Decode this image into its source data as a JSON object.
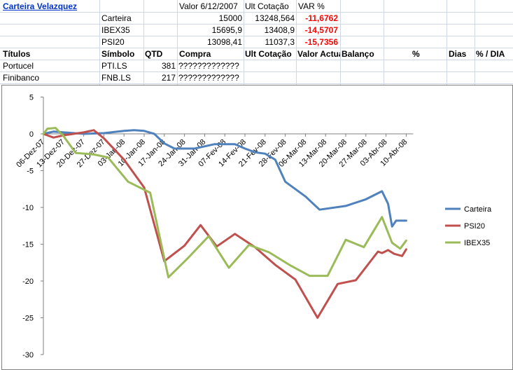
{
  "sheet": {
    "title": "Carteira Velazquez",
    "summary_headers": [
      "Valor 6/12/2007",
      "Ult Cotação",
      "VAR %"
    ],
    "summary_rows": [
      {
        "name": "Carteira",
        "valor": "15000",
        "ult": "13248,564",
        "var": "-11,6762"
      },
      {
        "name": "IBEX35",
        "valor": "15695,9",
        "ult": "13408,9",
        "var": "-14,5707"
      },
      {
        "name": "PSI20",
        "valor": "13098,41",
        "ult": "11037,3",
        "var": "-15,7356"
      }
    ],
    "table_headers": [
      "Títulos",
      "Símbolo",
      "QTD",
      "Compra",
      "Ult Cotação",
      "Valor Actual",
      "Balanço",
      "%",
      "Dias",
      "% / DIA"
    ],
    "rows": [
      {
        "titulo": "Portucel",
        "simbolo": "PTI.LS",
        "qtd": "381",
        "compra": "?????????????"
      },
      {
        "titulo": "Finibanco",
        "simbolo": "FNB.LS",
        "qtd": "217",
        "compra": "?????????????"
      }
    ]
  },
  "chart_data": {
    "type": "line",
    "categories": [
      "06-Dez-07",
      "13-Dez-07",
      "20-Dez-07",
      "27-Dez-07",
      "03-Jan-08",
      "10-Jan-08",
      "17-Jan-08",
      "24-Jan-08",
      "31-Jan-08",
      "07-Fev-08",
      "14-Fev-08",
      "21-Fev-08",
      "28-Fev-08",
      "06-Mar-08",
      "13-Mar-08",
      "20-Mar-08",
      "27-Mar-08",
      "03-Abr-08",
      "10-Abr-08"
    ],
    "ylim": [
      -30,
      5
    ],
    "yticks": [
      "5",
      "0",
      "-5",
      "-10",
      "-15",
      "-20",
      "-25",
      "-30"
    ],
    "series": [
      {
        "name": "Carteira",
        "color": "#4f81bd",
        "points": [
          [
            0,
            0
          ],
          [
            0.5,
            0.3
          ],
          [
            1,
            0.2
          ],
          [
            2,
            0
          ],
          [
            3,
            0.1
          ],
          [
            4,
            0.4
          ],
          [
            4.5,
            0.5
          ],
          [
            5,
            0.4
          ],
          [
            5.5,
            0
          ],
          [
            6,
            -1.3
          ],
          [
            6.5,
            -2
          ],
          [
            7,
            -2
          ],
          [
            7.5,
            -2
          ],
          [
            8,
            -1.7
          ],
          [
            8.5,
            -1.4
          ],
          [
            9,
            -1.4
          ],
          [
            9.5,
            -1.4
          ],
          [
            10,
            -2
          ],
          [
            10.5,
            -2.5
          ],
          [
            11,
            -2.7
          ],
          [
            11.5,
            -3.5
          ],
          [
            12,
            -6.5
          ],
          [
            13,
            -8.5
          ],
          [
            13.7,
            -10.3
          ],
          [
            15,
            -9.8
          ],
          [
            16,
            -8.9
          ],
          [
            16.8,
            -7.8
          ],
          [
            17.1,
            -9.5
          ],
          [
            17.3,
            -12.6
          ],
          [
            17.5,
            -11.8
          ],
          [
            18,
            -11.8
          ]
        ]
      },
      {
        "name": "PSI20",
        "color": "#c0504d",
        "points": [
          [
            0,
            0
          ],
          [
            0.5,
            -0.5
          ],
          [
            1,
            -0.2
          ],
          [
            2,
            0.2
          ],
          [
            2.5,
            0.5
          ],
          [
            3,
            -0.6
          ],
          [
            4,
            -3.5
          ],
          [
            5,
            -7.3
          ],
          [
            6,
            -17.3
          ],
          [
            7,
            -15.2
          ],
          [
            7.8,
            -12.4
          ],
          [
            8.6,
            -15.3
          ],
          [
            9.5,
            -13.6
          ],
          [
            10.5,
            -15.4
          ],
          [
            11.5,
            -17.8
          ],
          [
            12.5,
            -19.8
          ],
          [
            13.6,
            -25
          ],
          [
            14.6,
            -20.4
          ],
          [
            15.5,
            -19.9
          ],
          [
            16.6,
            -16
          ],
          [
            16.8,
            -16.2
          ],
          [
            17.1,
            -15.8
          ],
          [
            17.4,
            -16.3
          ],
          [
            17.8,
            -16.6
          ],
          [
            18,
            -15.7
          ]
        ]
      },
      {
        "name": "IBEX35",
        "color": "#9bbb59",
        "points": [
          [
            0,
            0
          ],
          [
            0.2,
            0.7
          ],
          [
            0.6,
            0.8
          ],
          [
            1,
            -0.3
          ],
          [
            1.6,
            -2.6
          ],
          [
            2.5,
            -2.8
          ],
          [
            3.2,
            -3.2
          ],
          [
            4.2,
            -6.5
          ],
          [
            5.3,
            -8
          ],
          [
            6.2,
            -19.5
          ],
          [
            7.2,
            -16.8
          ],
          [
            8.2,
            -13.9
          ],
          [
            9.2,
            -18.2
          ],
          [
            10.2,
            -15.1
          ],
          [
            11.2,
            -16.1
          ],
          [
            12.2,
            -17.8
          ],
          [
            13.2,
            -19.3
          ],
          [
            14.1,
            -19.3
          ],
          [
            15,
            -14.4
          ],
          [
            15.9,
            -15.4
          ],
          [
            16.8,
            -11.3
          ],
          [
            17.3,
            -14.8
          ],
          [
            17.7,
            -15.6
          ],
          [
            18,
            -14.5
          ]
        ]
      }
    ]
  }
}
